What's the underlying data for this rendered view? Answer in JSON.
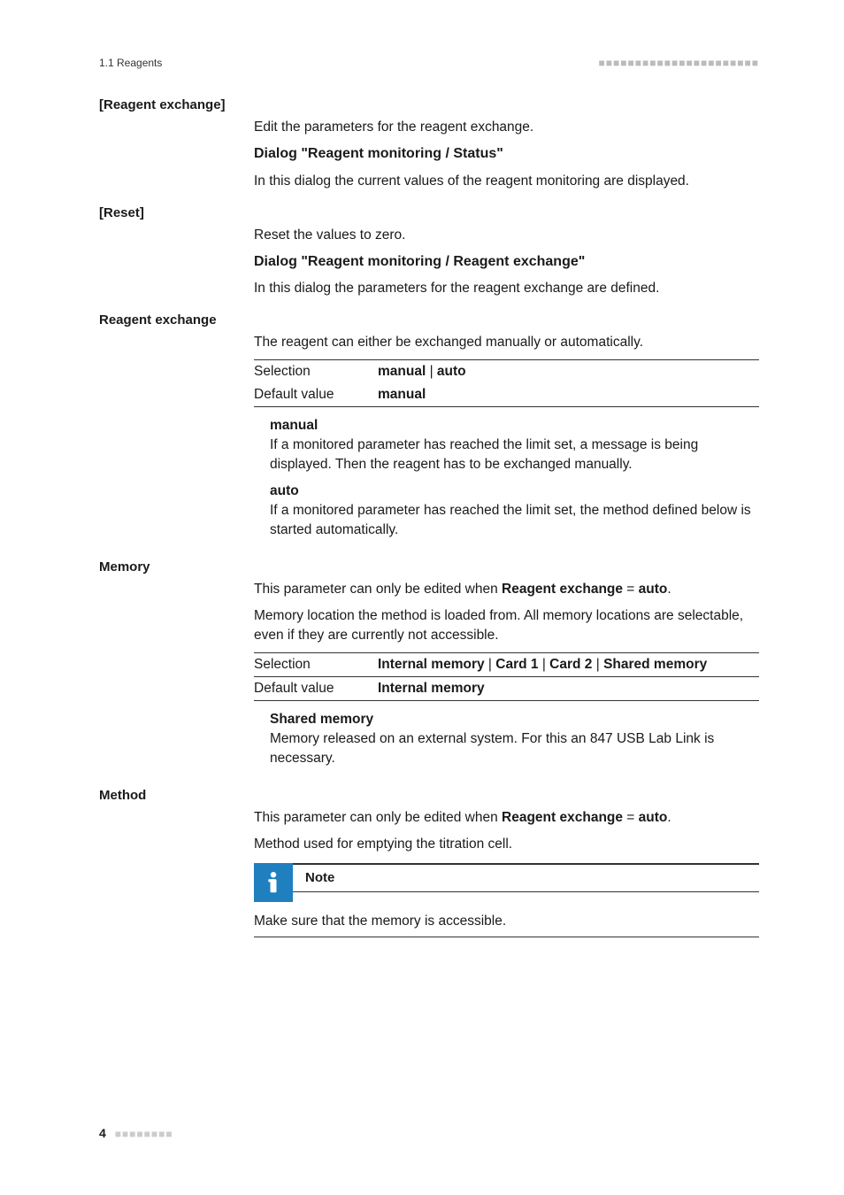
{
  "header": {
    "section_ref": "1.1 Reagents",
    "dashes": "■■■■■■■■■■■■■■■■■■■■■■"
  },
  "footer": {
    "page_number": "4",
    "dashes": "■■■■■■■■"
  },
  "s1": {
    "label": "[Reagent exchange]",
    "text": "Edit the parameters for the reagent exchange."
  },
  "h1": {
    "title": "Dialog \"Reagent monitoring / Status\"",
    "text": "In this dialog the current values of the reagent monitoring are displayed."
  },
  "s2": {
    "label": "[Reset]",
    "text": "Reset the values to zero."
  },
  "h2": {
    "title": "Dialog \"Reagent monitoring / Reagent exchange\"",
    "text": "In this dialog the parameters for the reagent exchange are defined."
  },
  "s3": {
    "label": "Reagent exchange",
    "intro": "The reagent can either be exchanged manually or automatically.",
    "kv": {
      "selection_label": "Selection",
      "selection_value": "manual | auto",
      "default_label": "Default value",
      "default_value": "manual"
    },
    "def1_term": "manual",
    "def1_text": "If a monitored parameter has reached the limit set, a message is being displayed. Then the reagent has to be exchanged manually.",
    "def2_term": "auto",
    "def2_text": "If a monitored parameter has reached the limit set, the method defined below is started automatically."
  },
  "s4": {
    "label": "Memory",
    "p1a": "This parameter can only be edited when ",
    "p1b": "Reagent exchange",
    "p1c": " = ",
    "p1d": "auto",
    "p1e": ".",
    "p2": "Memory location the method is loaded from. All memory locations are selectable, even if they are currently not accessible.",
    "kv": {
      "selection_label": "Selection",
      "selection_value": "Internal memory | Card 1 | Card 2 | Shared memory",
      "default_label": "Default value",
      "default_value": "Internal memory"
    },
    "def1_term": "Shared memory",
    "def1_text": "Memory released on an external system. For this an 847 USB Lab Link is necessary."
  },
  "s5": {
    "label": "Method",
    "p1a": "This parameter can only be edited when ",
    "p1b": "Reagent exchange",
    "p1c": " = ",
    "p1d": "auto",
    "p1e": ".",
    "p2": "Method used for emptying the titration cell.",
    "note_label": "Note",
    "note_text": "Make sure that the memory is accessible."
  }
}
